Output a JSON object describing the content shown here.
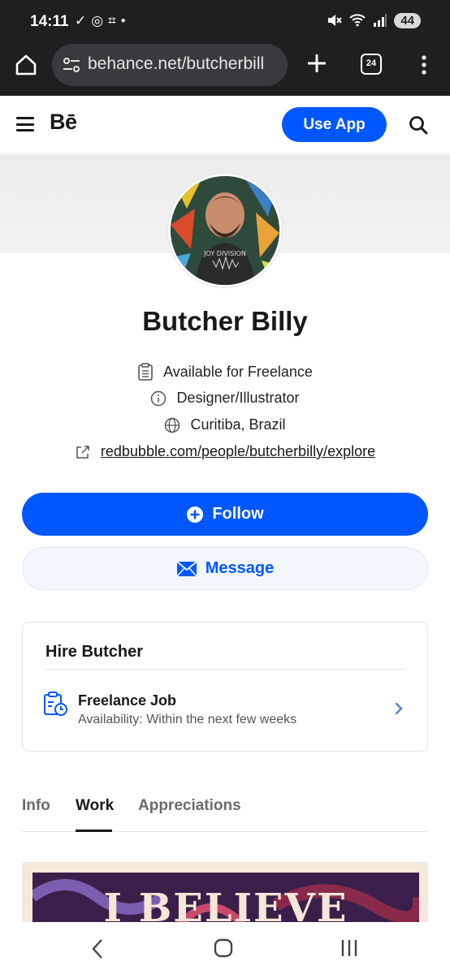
{
  "status_bar": {
    "time": "14:11",
    "battery": "44"
  },
  "browser": {
    "url": "behance.net/butcherbill",
    "tab_count": "24"
  },
  "header": {
    "logo": "Bē",
    "use_app_label": "Use App"
  },
  "profile": {
    "name": "Butcher Billy",
    "availability": "Available for Freelance",
    "occupation": "Designer/Illustrator",
    "location": "Curitiba, Brazil",
    "website": "redbubble.com/people/butcherbilly/explore",
    "avatar_shirt_text": "JOY DIVISION"
  },
  "actions": {
    "follow_label": "Follow",
    "message_label": "Message"
  },
  "hire": {
    "title": "Hire Butcher",
    "job_title": "Freelance Job",
    "job_subtitle": "Availability: Within the next few weeks"
  },
  "tabs": [
    {
      "label": "Info",
      "active": false
    },
    {
      "label": "Work",
      "active": true
    },
    {
      "label": "Appreciations",
      "active": false
    }
  ],
  "work_preview": {
    "art_text": "I BELIEVE"
  },
  "colors": {
    "brand_blue": "#0057ff",
    "browser_chrome": "#1f1f22"
  }
}
